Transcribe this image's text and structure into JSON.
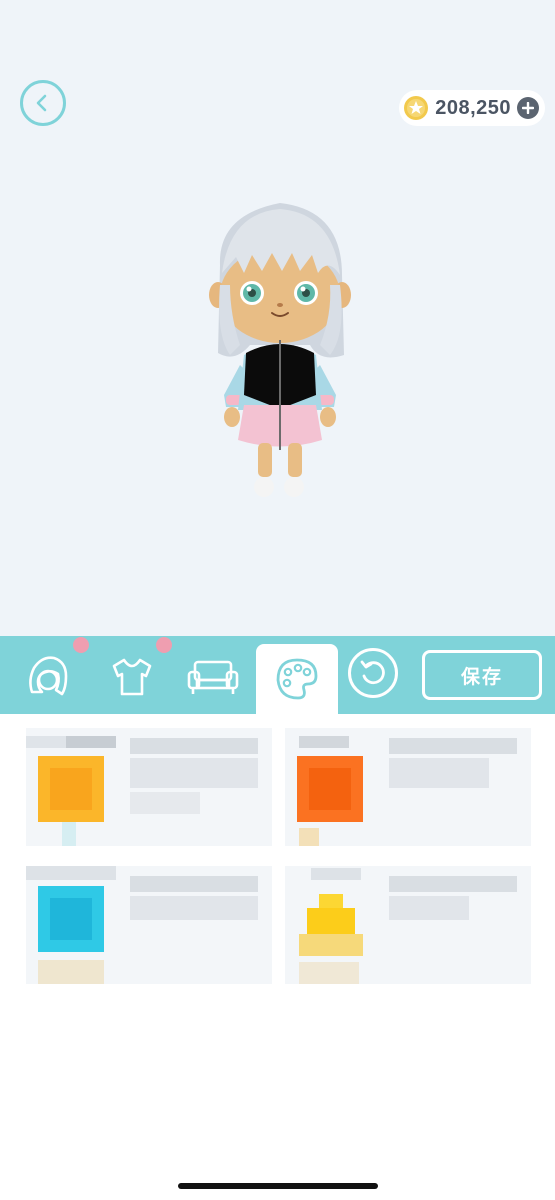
{
  "header": {
    "coins": "208,250",
    "icons": {
      "back": "chevron-left-icon",
      "coin": "star-coin-icon",
      "add": "plus-icon"
    }
  },
  "tabs": [
    {
      "name": "hair",
      "icon": "hair-icon",
      "badge": true,
      "active": false
    },
    {
      "name": "clothing",
      "icon": "tshirt-icon",
      "badge": true,
      "active": false
    },
    {
      "name": "furniture",
      "icon": "sofa-icon",
      "badge": false,
      "active": false
    },
    {
      "name": "color",
      "icon": "palette-icon",
      "badge": false,
      "active": true
    }
  ],
  "actions": {
    "save_label": "保存",
    "reset_icon": "undo-icon"
  },
  "colors": {
    "accent": "#7fd3d9",
    "badge": "#ef9eb0",
    "background": "#eff4f9",
    "coin": "#f2c94c"
  },
  "items": [
    {
      "swatch": "#fbb62a",
      "icon": "color-drop-icon"
    },
    {
      "swatch": "#fb7221",
      "icon": "color-drop-icon"
    },
    {
      "swatch": "#2fc9e6",
      "icon": "color-drop-icon"
    },
    {
      "swatch": "#fcd733",
      "icon": "color-drop-icon"
    }
  ]
}
